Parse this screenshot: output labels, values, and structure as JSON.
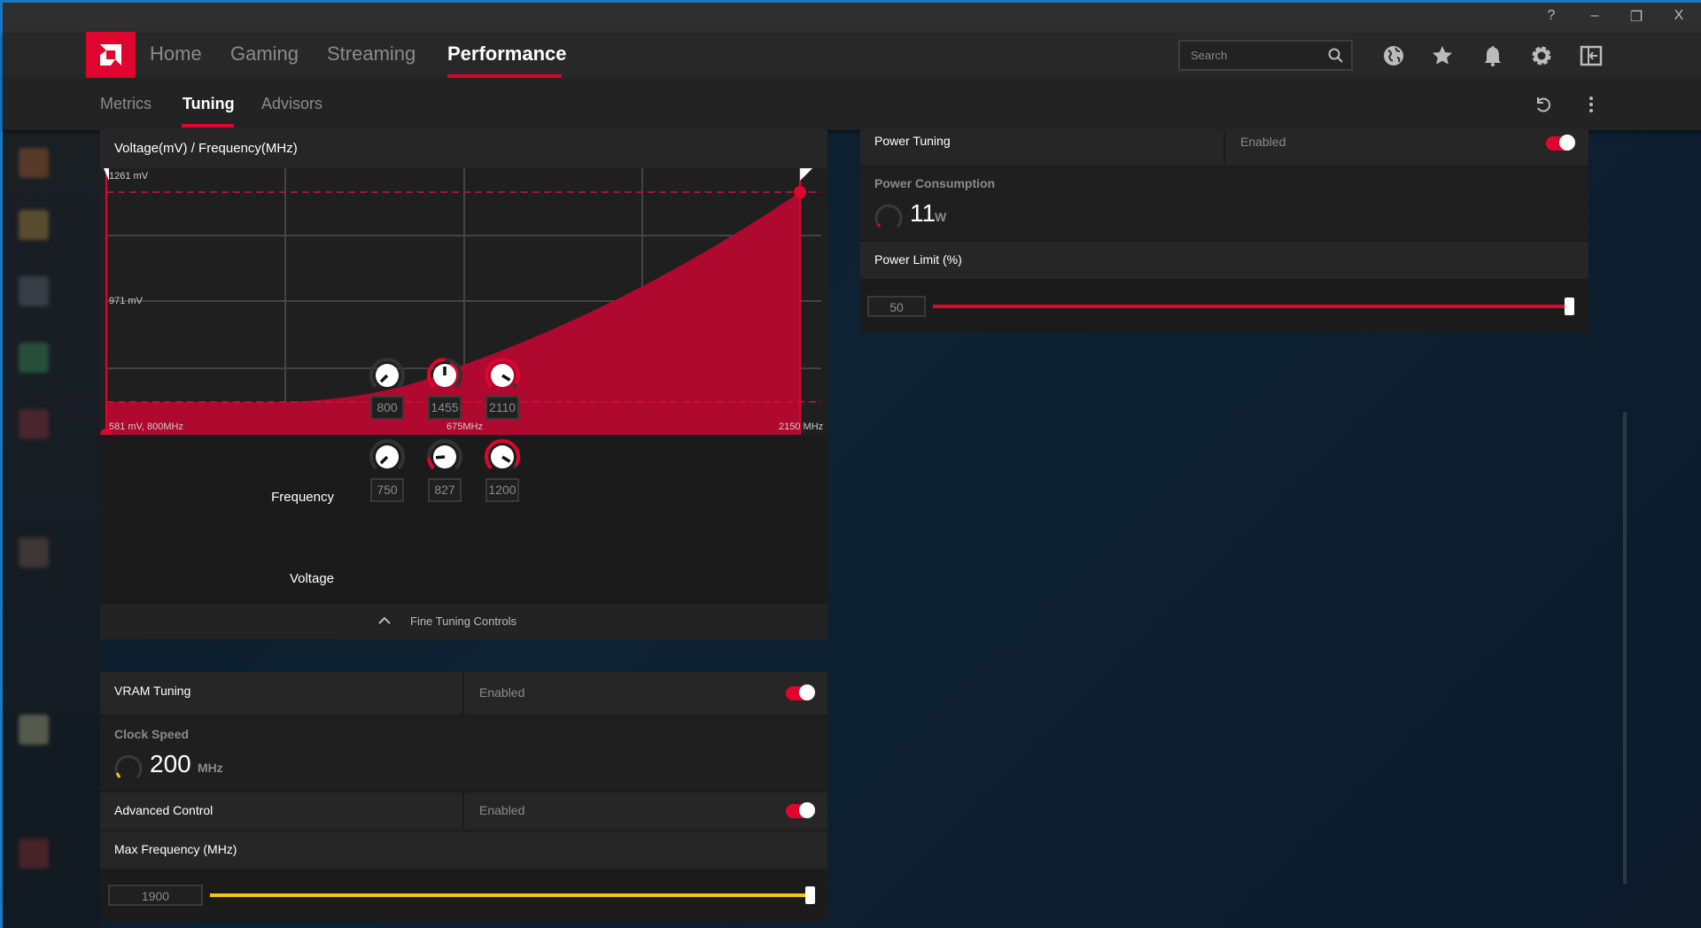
{
  "window": {
    "help_icon": "?",
    "minimize_icon": "–",
    "restore_icon": "❐",
    "close_icon": "X"
  },
  "nav": {
    "items": [
      "Home",
      "Gaming",
      "Streaming",
      "Performance"
    ],
    "active": "Performance"
  },
  "subnav": {
    "items": [
      "Metrics",
      "Tuning",
      "Advisors"
    ],
    "active": "Tuning"
  },
  "search": {
    "placeholder": "Search"
  },
  "vf_panel": {
    "title": "Voltage(mV) / Frequency(MHz)",
    "frequency_label": "Frequency",
    "voltage_label": "Voltage",
    "frequency_values": [
      "800",
      "1455",
      "2110"
    ],
    "voltage_values": [
      "750",
      "827",
      "1200"
    ],
    "frequency_knob_levels": [
      0.0,
      0.5,
      0.95
    ],
    "voltage_knob_levels": [
      0.0,
      0.15,
      0.95
    ],
    "footer": "Fine Tuning Controls"
  },
  "chart_data": {
    "type": "area",
    "title": "Voltage(mV) / Frequency(MHz)",
    "xlim": [
      800,
      2150
    ],
    "ylim": [
      581,
      1261
    ],
    "y_labels": [
      "1261 mV",
      "971 mV"
    ],
    "x_labels": [
      "581 mV, 800MHz",
      "675MHz",
      "2150 MHz"
    ],
    "curve": [
      [
        800,
        665
      ],
      [
        1150,
        665
      ],
      [
        1455,
        750
      ],
      [
        2110,
        1200
      ]
    ],
    "markers": [
      [
        800,
        581
      ],
      [
        1455,
        750
      ],
      [
        2110,
        1200
      ]
    ],
    "dashed_limits": [
      1200,
      665
    ],
    "color": "#b0092f"
  },
  "vram": {
    "title": "VRAM Tuning",
    "status": "Enabled",
    "clock_label": "Clock Speed",
    "clock_value": "200",
    "clock_unit": "MHz",
    "advanced_label": "Advanced Control",
    "advanced_status": "Enabled",
    "maxfreq_label": "Max Frequency (MHz)",
    "maxfreq_value": "1900",
    "maxfreq_fill": 1.0,
    "accent": "#f5c518"
  },
  "power": {
    "title": "Power Tuning",
    "status": "Enabled",
    "consumption_label": "Power Consumption",
    "consumption_value": "11",
    "consumption_unit": "W",
    "limit_label": "Power Limit (%)",
    "limit_value": "50",
    "limit_fill": 1.0,
    "accent": "#e0052f"
  }
}
